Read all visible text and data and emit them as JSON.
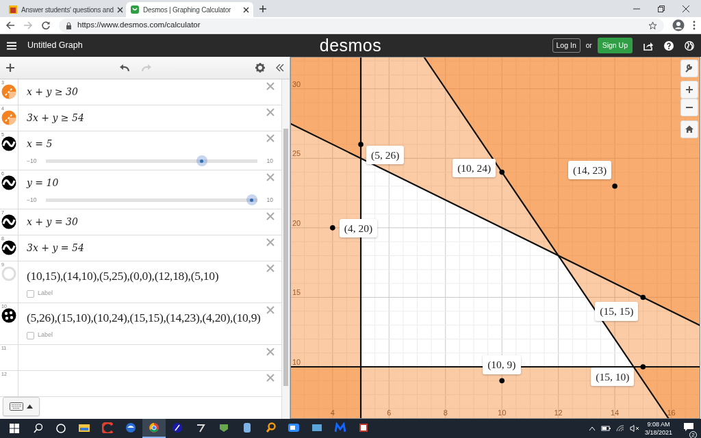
{
  "browser": {
    "tabs": [
      {
        "title": "Answer students' questions and",
        "selected": false
      },
      {
        "title": "Desmos | Graphing Calculator",
        "selected": true
      }
    ],
    "url": "https://www.desmos.com/calculator"
  },
  "header": {
    "title": "Untitled Graph",
    "logo": "desmos",
    "login": "Log In",
    "or": "or",
    "signup": "Sign Up"
  },
  "expressions": [
    {
      "number": "3",
      "kind": "inequality",
      "latex": "x + y ≥ 30"
    },
    {
      "number": "4",
      "kind": "inequality",
      "latex": "3x + y ≥ 54"
    },
    {
      "number": "5",
      "kind": "slider",
      "latex": "x = 5",
      "min": "−10",
      "max": "10",
      "level": 0.75
    },
    {
      "number": "6",
      "kind": "slider",
      "latex": "y = 10",
      "min": "−10",
      "max": "10",
      "level": 1
    },
    {
      "number": "7",
      "kind": "equation",
      "latex": "x + y = 30"
    },
    {
      "number": "8",
      "kind": "equation",
      "latex": "3x + y = 54"
    },
    {
      "number": "9",
      "kind": "points",
      "hidden": true,
      "latex": "(10,15),(14,10),(5,25),(0,0),(12,18),(5,10)",
      "label": "Label",
      "checked": false
    },
    {
      "number": "10",
      "kind": "points",
      "hidden": false,
      "latex": "(5,26),(15,10),(10,24),(15,15),(14,23),(4,20),(10,9)",
      "label": "Label",
      "checked": false
    },
    {
      "number": "11",
      "kind": "empty"
    },
    {
      "number": "12",
      "kind": "empty"
    }
  ],
  "graph": {
    "chart_data": {
      "type": "scatter",
      "x": [
        5,
        15,
        10,
        15,
        14,
        4,
        10
      ],
      "series": [
        {
          "color": "#000000",
          "values": [
            26,
            10,
            24,
            15,
            23,
            20,
            9
          ]
        }
      ],
      "xlim": [
        2.5,
        17.03
      ],
      "ylim": [
        6.26,
        32.3
      ],
      "xticks": [
        {
          "value": 4,
          "label": "4"
        },
        {
          "value": 6,
          "label": "6"
        },
        {
          "value": 8,
          "label": "8"
        },
        {
          "value": 10,
          "label": "10"
        },
        {
          "value": 12,
          "label": "12"
        },
        {
          "value": 14,
          "label": "14"
        },
        {
          "value": 16,
          "label": "16"
        }
      ],
      "yticks": [
        {
          "value": 10,
          "label": "10"
        },
        {
          "value": 15,
          "label": "15"
        },
        {
          "value": 20,
          "label": "20"
        },
        {
          "value": 25,
          "label": "25"
        },
        {
          "value": 30,
          "label": "30"
        }
      ],
      "grid": true,
      "value_labels": [
        "(5, 26)",
        "(15, 10)",
        "(10, 24)",
        "(15, 15)",
        "(14, 23)",
        "(4, 20)",
        "(10, 9)"
      ]
    }
  },
  "taskbar": {
    "apps": [
      {
        "selected": false
      },
      {
        "selected": false
      },
      {
        "selected": false
      },
      {
        "selected": true
      },
      {
        "selected": false
      },
      {
        "selected": false
      },
      {
        "selected": false
      },
      {
        "selected": false
      },
      {
        "selected": false
      },
      {
        "selected": false
      },
      {
        "selected": false
      },
      {
        "selected": false
      },
      {
        "selected": false
      }
    ],
    "time": "9:08 AM",
    "date": "3/18/2021",
    "notifications": "2"
  }
}
